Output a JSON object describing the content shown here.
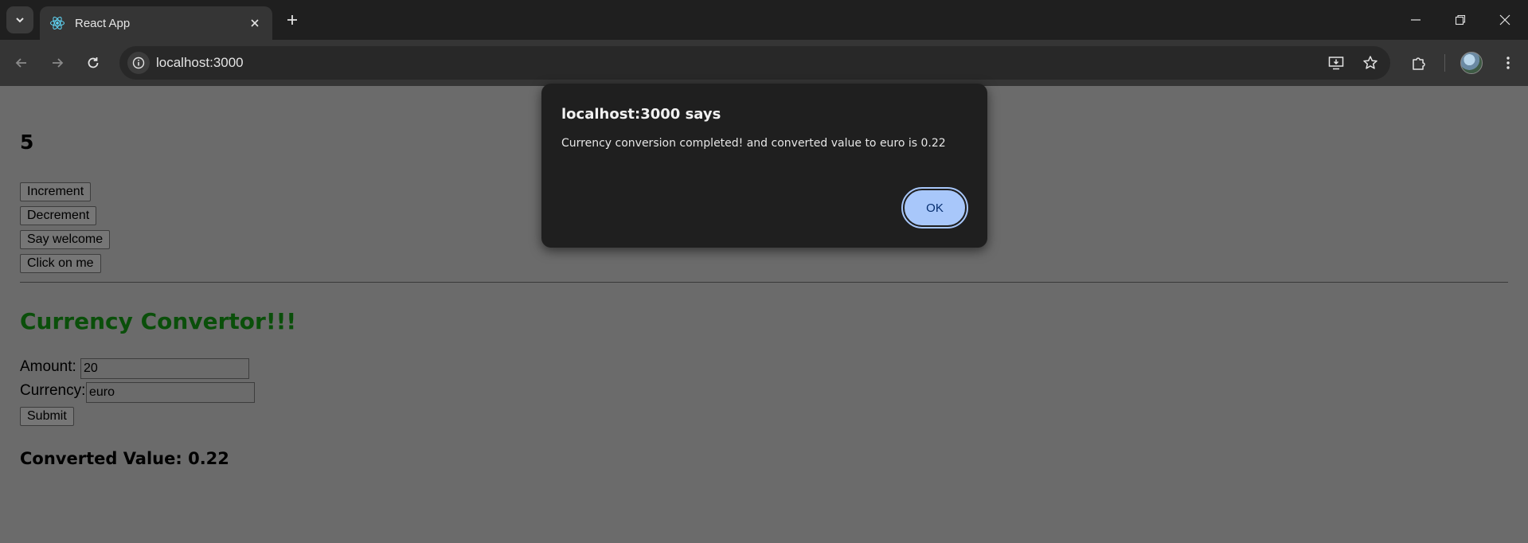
{
  "browser": {
    "tab_title": "React App",
    "url": "localhost:3000",
    "icons": {
      "tab_search": "chevron-down-icon",
      "favicon": "react-icon",
      "tab_close": "close-icon",
      "new_tab": "plus-icon",
      "minimize": "minimize-icon",
      "restore": "restore-icon",
      "close": "close-icon",
      "back": "arrow-left-icon",
      "forward": "arrow-right-icon",
      "reload": "reload-icon",
      "site_info": "info-icon",
      "install": "install-app-icon",
      "bookmark": "star-icon",
      "extensions": "puzzle-icon",
      "menu": "kebab-menu-icon"
    }
  },
  "page": {
    "counter_value": "5",
    "buttons": {
      "increment": "Increment",
      "decrement": "Decrement",
      "say_welcome": "Say welcome",
      "click_on_me": "Click on me"
    },
    "converter": {
      "title": "Currency Convertor!!!",
      "amount_label": "Amount:",
      "amount_value": "20",
      "currency_label": "Currency:",
      "currency_value": "euro",
      "submit_label": "Submit",
      "result_text": "Converted Value: 0.22"
    }
  },
  "dialog": {
    "title": "localhost:3000 says",
    "message": "Currency conversion completed! and converted value to euro is 0.22",
    "ok_label": "OK"
  },
  "colors": {
    "chrome_dark": "#1f1f1f",
    "toolbar": "#353535",
    "page_overlay": "#6b6b6b",
    "heading_green": "#0a4f0a",
    "ok_button": "#a8c7fa"
  }
}
